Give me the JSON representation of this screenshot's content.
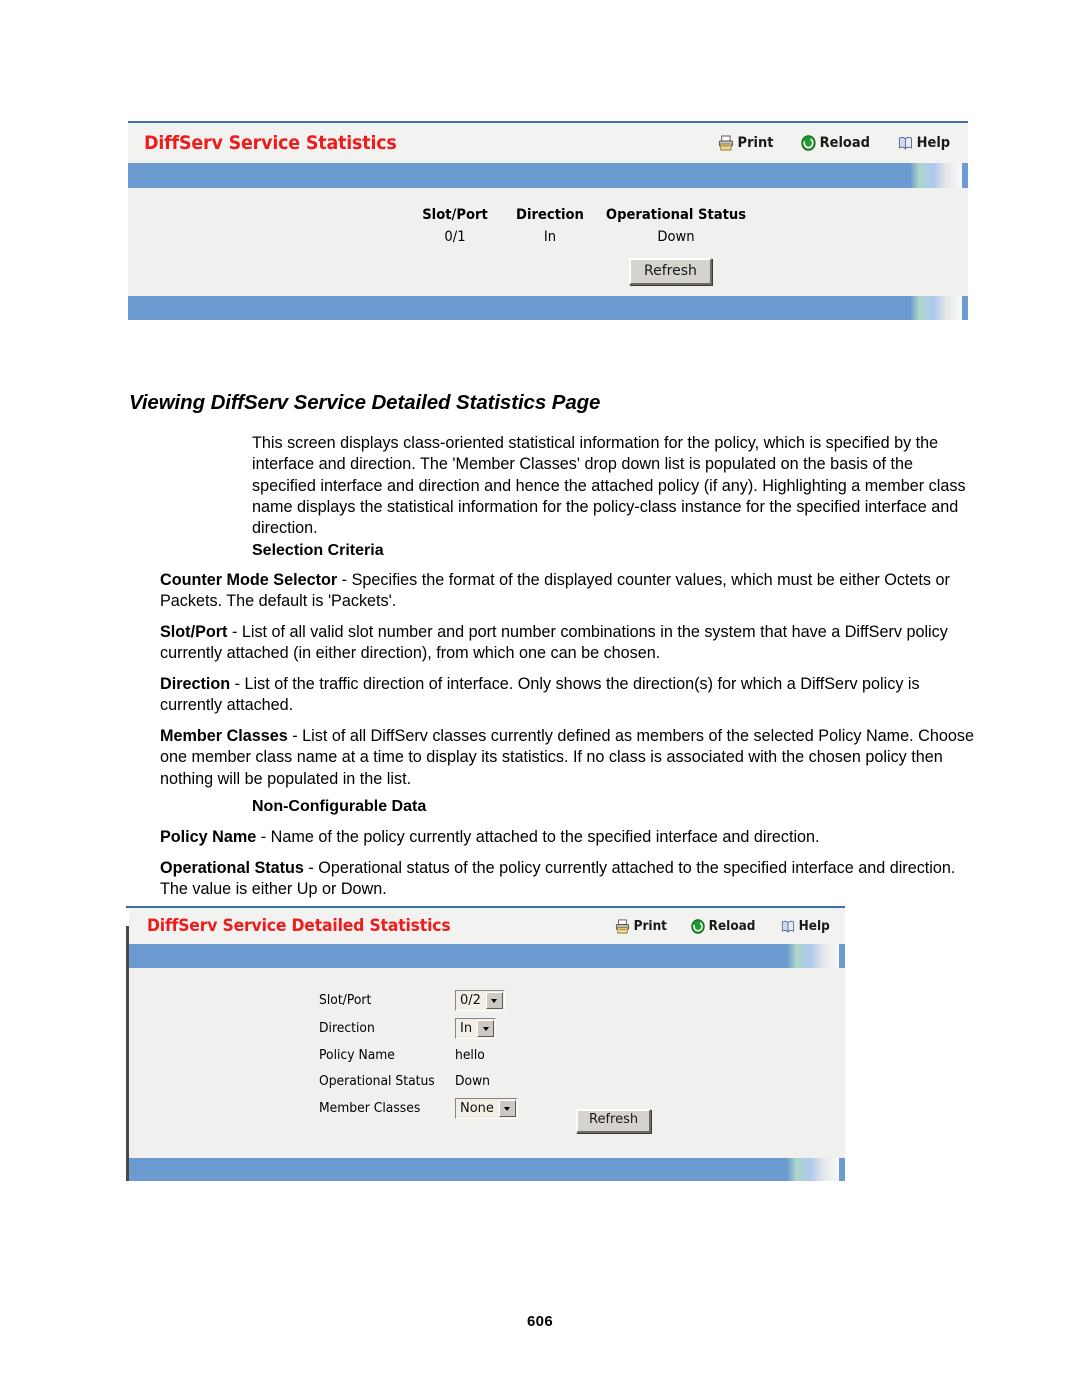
{
  "document": {
    "heading": "Viewing DiffServ Service Detailed Statistics Page",
    "intro_paragraph": "This screen displays class-oriented statistical information for the policy, which is specified by the interface and direction. The 'Member Classes' drop down list is populated on the basis of the specified interface and direction and hence the attached policy (if any). Highlighting a member class name displays the statistical information for the policy-class instance for the specified interface and direction.",
    "selection_criteria_heading": "Selection Criteria",
    "non_configurable_heading": "Non-Configurable Data",
    "definitions": [
      {
        "term": "Counter Mode Selector",
        "text": " - Specifies the format of the displayed counter values, which must be either Octets or Packets. The default is 'Packets'."
      },
      {
        "term": "Slot/Port",
        "text": " - List of all valid slot number and port number combinations in the system that have a DiffServ policy currently attached (in either direction), from which one can be chosen."
      },
      {
        "term": "Direction",
        "text": " - List of the traffic direction of interface. Only shows the direction(s) for which a DiffServ policy is currently attached."
      },
      {
        "term": "Member Classes",
        "text": " - List of all DiffServ classes currently defined as members of the selected Policy Name. Choose one member class name at a time to display its statistics. If no class is associated with the chosen policy then nothing will be populated in the list."
      },
      {
        "term": "Policy Name",
        "text": " - Name of the policy currently attached to the specified interface and direction."
      },
      {
        "term": "Operational Status",
        "text": " - Operational status of the policy currently attached to the specified interface and direction. The value is either Up or Down."
      }
    ],
    "page_number": "606"
  },
  "colors": {
    "title_red": "#ee1c1c",
    "bar_blue": "#6b9bd0",
    "panel_bg": "#f0f0ee",
    "button_face": "#d6d3ce",
    "select_face": "#f4efe6"
  },
  "panel_top": {
    "title": "DiffServ Service Statistics",
    "actions": [
      {
        "icon": "print-icon",
        "label": "Print"
      },
      {
        "icon": "reload-icon",
        "label": "Reload"
      },
      {
        "icon": "help-icon",
        "label": "Help"
      }
    ],
    "table": {
      "headers": [
        "Slot/Port",
        "Direction",
        "Operational Status"
      ],
      "rows": [
        [
          "0/1",
          "In",
          "Down"
        ]
      ]
    },
    "refresh_label": "Refresh"
  },
  "panel_bottom": {
    "title": "DiffServ Service Detailed Statistics",
    "actions": [
      {
        "icon": "print-icon",
        "label": "Print"
      },
      {
        "icon": "reload-icon",
        "label": "Reload"
      },
      {
        "icon": "help-icon",
        "label": "Help"
      }
    ],
    "fields": [
      {
        "label": "Slot/Port",
        "type": "select",
        "value": "0/2"
      },
      {
        "label": "Direction",
        "type": "select",
        "value": "In"
      },
      {
        "label": "Policy Name",
        "type": "static",
        "value": "hello"
      },
      {
        "label": "Operational Status",
        "type": "static",
        "value": "Down"
      },
      {
        "label": "Member Classes",
        "type": "select",
        "value": "None"
      }
    ],
    "refresh_label": "Refresh"
  }
}
